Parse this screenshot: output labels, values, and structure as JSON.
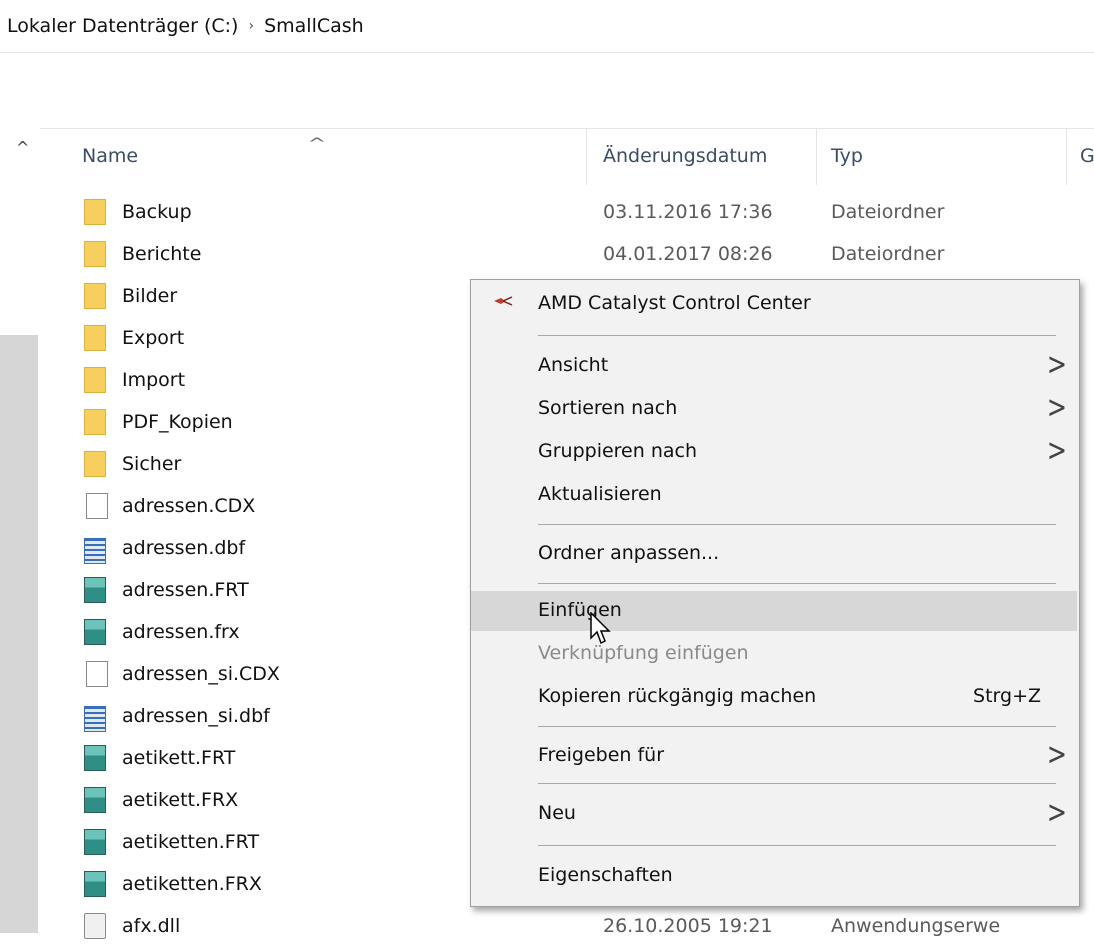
{
  "breadcrumb": {
    "drive": "Lokaler Datenträger (C:)",
    "separator": "›",
    "folder": "SmallCash"
  },
  "columns": {
    "name": "Name",
    "date": "Änderungsdatum",
    "type": "Typ",
    "size": "G"
  },
  "rows": [
    {
      "name": "Backup",
      "date": "03.11.2016 17:36",
      "type": "Dateiordner"
    },
    {
      "name": "Berichte",
      "date": "04.01.2017 08:26",
      "type": "Dateiordner"
    },
    {
      "name": "Bilder"
    },
    {
      "name": "Export"
    },
    {
      "name": "Import"
    },
    {
      "name": "PDF_Kopien"
    },
    {
      "name": "Sicher"
    },
    {
      "name": "adressen.CDX"
    },
    {
      "name": "adressen.dbf"
    },
    {
      "name": "adressen.FRT"
    },
    {
      "name": "adressen.frx"
    },
    {
      "name": "adressen_si.CDX"
    },
    {
      "name": "adressen_si.dbf"
    },
    {
      "name": "aetikett.FRT"
    },
    {
      "name": "aetikett.FRX"
    },
    {
      "name": "aetiketten.FRT"
    },
    {
      "name": "aetiketten.FRX"
    },
    {
      "name": "afx.dll",
      "date": "26.10.2005 19:21",
      "type": "Anwendungserwe"
    }
  ],
  "context_menu": {
    "amd": "AMD Catalyst Control Center",
    "view": "Ansicht",
    "sort": "Sortieren nach",
    "group": "Gruppieren nach",
    "refresh": "Aktualisieren",
    "customize": "Ordner anpassen...",
    "paste": "Einfügen",
    "paste_shortcut": "Verknüpfung einfügen",
    "undo_copy": "Kopieren rückgängig machen",
    "undo_copy_key": "Strg+Z",
    "share": "Freigeben für",
    "new": "Neu",
    "properties": "Eigenschaften",
    "arrow": ">"
  },
  "icons": {
    "folder": "folder-icon",
    "file": "file-icon",
    "dbf": "table-file-icon",
    "frt": "report-file-icon",
    "dll": "dll-file-icon",
    "amd": "amd-logo-icon"
  },
  "colors": {
    "folder": "#f7cf5e",
    "menu_bg": "#f2f2f2",
    "menu_hover": "#d7d7d7"
  }
}
